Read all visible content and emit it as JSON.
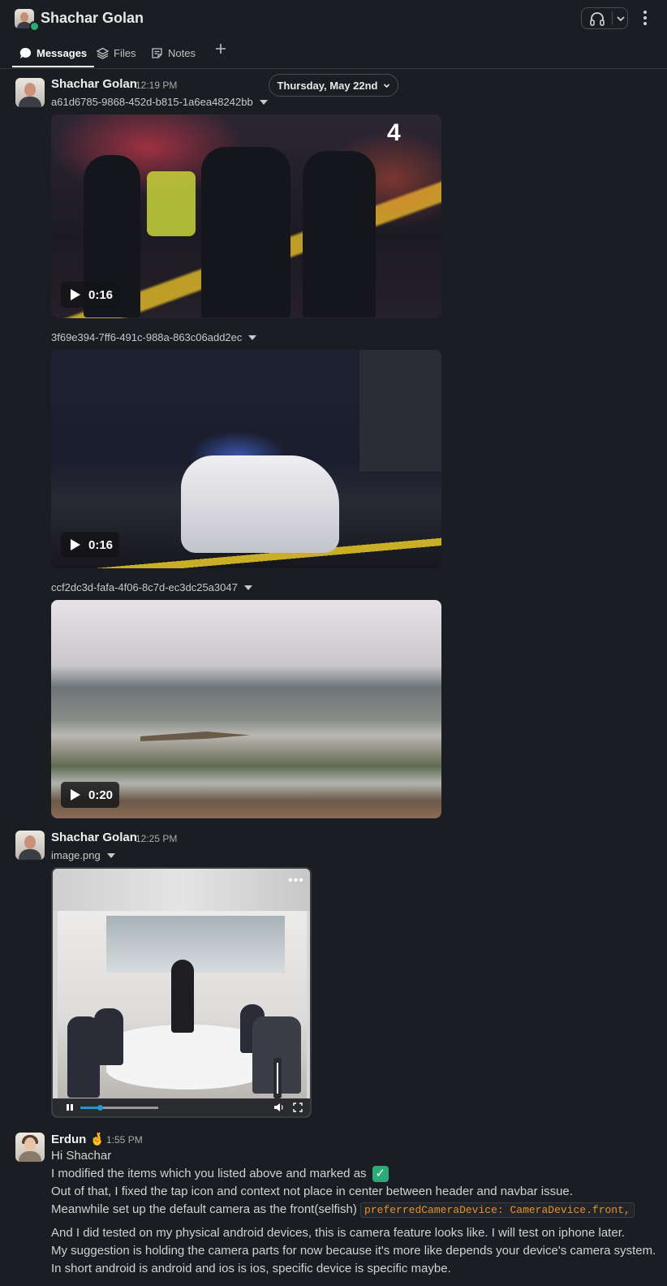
{
  "header": {
    "title": "Shachar Golan",
    "icons": {
      "huddle": "headphones-icon",
      "dropdown": "chevron-down-icon",
      "more": "kebab-icon"
    }
  },
  "tabs": [
    {
      "label": "Messages",
      "icon": "chat-bubble-icon",
      "active": true
    },
    {
      "label": "Files",
      "icon": "layers-icon",
      "active": false
    },
    {
      "label": "Notes",
      "icon": "note-icon",
      "active": false
    }
  ],
  "date_divider": "Thursday, May 22nd",
  "messages": [
    {
      "sender": "Shachar Golan",
      "time": "12:19 PM",
      "attachments": [
        {
          "name": "a61d6785-9868-452d-b815-1a6ea48242bb",
          "duration": "0:16"
        },
        {
          "name": "3f69e394-7ff6-491c-988a-863c06add2ec",
          "duration": "0:16"
        },
        {
          "name": "ccf2dc3d-fafa-4f06-8c7d-ec3dc25a3047",
          "duration": "0:20"
        }
      ]
    },
    {
      "sender": "Shachar Golan",
      "time": "12:25 PM",
      "attachment": {
        "name": "image.png",
        "more": "•••",
        "progress_pct": 25
      }
    },
    {
      "sender": "Erdun",
      "emoji": "🤞",
      "time": "1:55 PM",
      "lines": [
        "Hi Shachar",
        "I modified the items which you listed above and marked as",
        "Out of that, I fixed the tap icon and context not place in center between header and navbar issue.",
        "Meanwhile set up the default camera as the front(selfish)",
        "And I did tested on my physical android devices, this is camera feature looks like. I will test on iphone later.",
        "My suggestion is holding the camera parts for now because it's more like depends your device's camera system.",
        "In short android is android and ios is ios, specific device is specific maybe."
      ],
      "check": "✓",
      "code": "preferredCameraDevice: CameraDevice.front,"
    }
  ]
}
